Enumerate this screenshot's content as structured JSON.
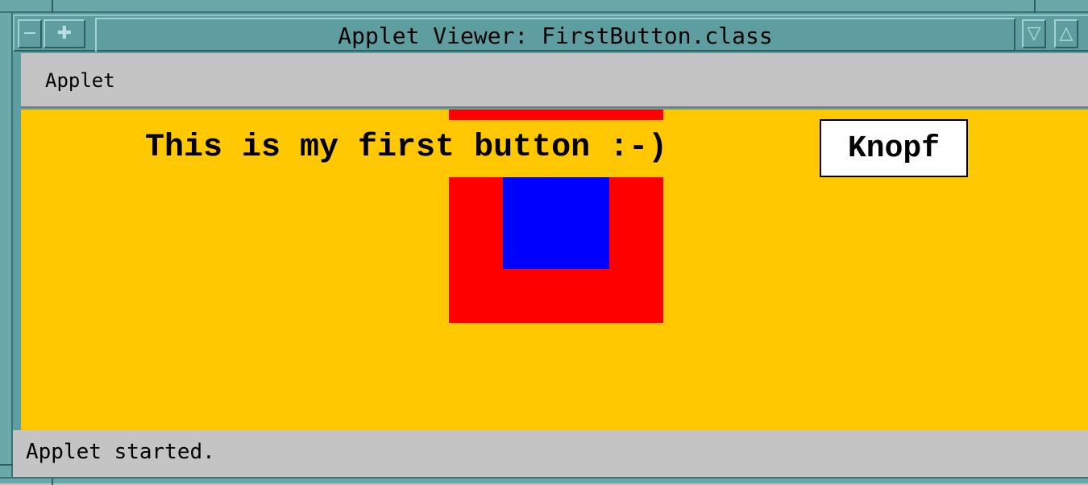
{
  "window": {
    "title": "Applet Viewer: FirstButton.class",
    "frame_color": "#5f9ea0",
    "titlebar_buttons": {
      "minimize_glyph": "−",
      "maximize_glyph": "✚",
      "lower_glyph": "▽",
      "raise_glyph": "△"
    }
  },
  "menubar": {
    "items": [
      {
        "label": "Applet"
      }
    ]
  },
  "applet": {
    "background_color": "#ffc800",
    "label_text": "This is my first button :-)",
    "button_label": "Knopf",
    "red_box_color": "#ff0000",
    "blue_box_color": "#0000ff"
  },
  "statusbar": {
    "text": "Applet started."
  }
}
